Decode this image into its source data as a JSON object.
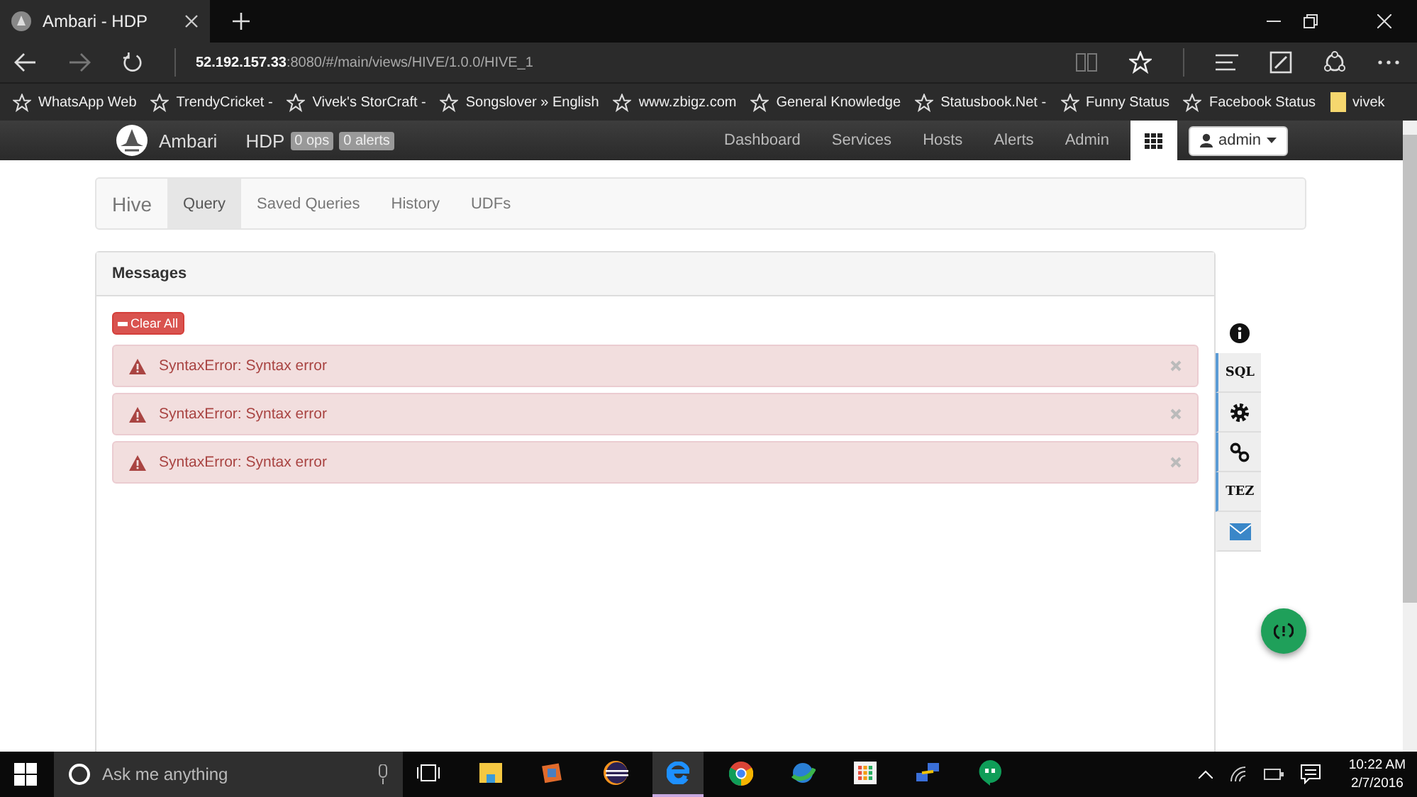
{
  "browser": {
    "tab_title": "Ambari - HDP",
    "address": {
      "host": "52.192.157.33",
      "path": ":8080/#/main/views/HIVE/1.0.0/HIVE_1"
    },
    "favorites": [
      {
        "label": "WhatsApp Web",
        "kind": "star"
      },
      {
        "label": "TrendyCricket -",
        "kind": "star"
      },
      {
        "label": "Vivek's StorCraft -",
        "kind": "star"
      },
      {
        "label": "Songslover » English",
        "kind": "star"
      },
      {
        "label": "www.zbigz.com",
        "kind": "star"
      },
      {
        "label": "General Knowledge",
        "kind": "star"
      },
      {
        "label": "Statusbook.Net -",
        "kind": "star"
      },
      {
        "label": "Funny Status",
        "kind": "star"
      },
      {
        "label": "Facebook Status",
        "kind": "star"
      },
      {
        "label": "vivek",
        "kind": "folder"
      }
    ]
  },
  "navbar": {
    "brand": "Ambari",
    "cluster": "HDP",
    "badges": [
      "0 ops",
      "0 alerts"
    ],
    "items": [
      {
        "label": "Dashboard",
        "selected": false
      },
      {
        "label": "Services",
        "selected": false
      },
      {
        "label": "Hosts",
        "selected": false
      },
      {
        "label": "Alerts",
        "selected": false
      },
      {
        "label": "Admin",
        "selected": false
      }
    ],
    "grid_selected": true,
    "user": "admin"
  },
  "hive_nav": {
    "title": "Hive",
    "tabs": [
      {
        "label": "Query",
        "selected": true
      },
      {
        "label": "Saved Queries",
        "selected": false
      },
      {
        "label": "History",
        "selected": false
      },
      {
        "label": "UDFs",
        "selected": false
      }
    ]
  },
  "messages": {
    "title": "Messages",
    "clear_button": "Clear All",
    "alerts": [
      {
        "text": "SyntaxError: Syntax error"
      },
      {
        "text": "SyntaxError: Syntax error"
      },
      {
        "text": "SyntaxError: Syntax error"
      }
    ]
  },
  "side_panel": [
    {
      "kind": "info",
      "accent": false
    },
    {
      "kind": "text",
      "label": "SQL",
      "accent": true
    },
    {
      "kind": "gear",
      "accent": true
    },
    {
      "kind": "link",
      "accent": true
    },
    {
      "kind": "text",
      "label": "TEZ",
      "accent": true
    },
    {
      "kind": "mail",
      "accent": false
    }
  ],
  "taskbar": {
    "search_placeholder": "Ask me anything",
    "apps": [
      {
        "kind": "taskview",
        "selected": false
      },
      {
        "kind": "folder",
        "selected": false
      },
      {
        "kind": "media",
        "selected": false
      },
      {
        "kind": "eclipse",
        "selected": false
      },
      {
        "kind": "edge",
        "selected": true
      },
      {
        "kind": "chrome",
        "selected": false
      },
      {
        "kind": "globe",
        "selected": false
      },
      {
        "kind": "tiles",
        "selected": false
      },
      {
        "kind": "network",
        "selected": false
      },
      {
        "kind": "chat",
        "selected": false
      }
    ],
    "time": "10:22 AM",
    "date": "2/7/2016"
  }
}
